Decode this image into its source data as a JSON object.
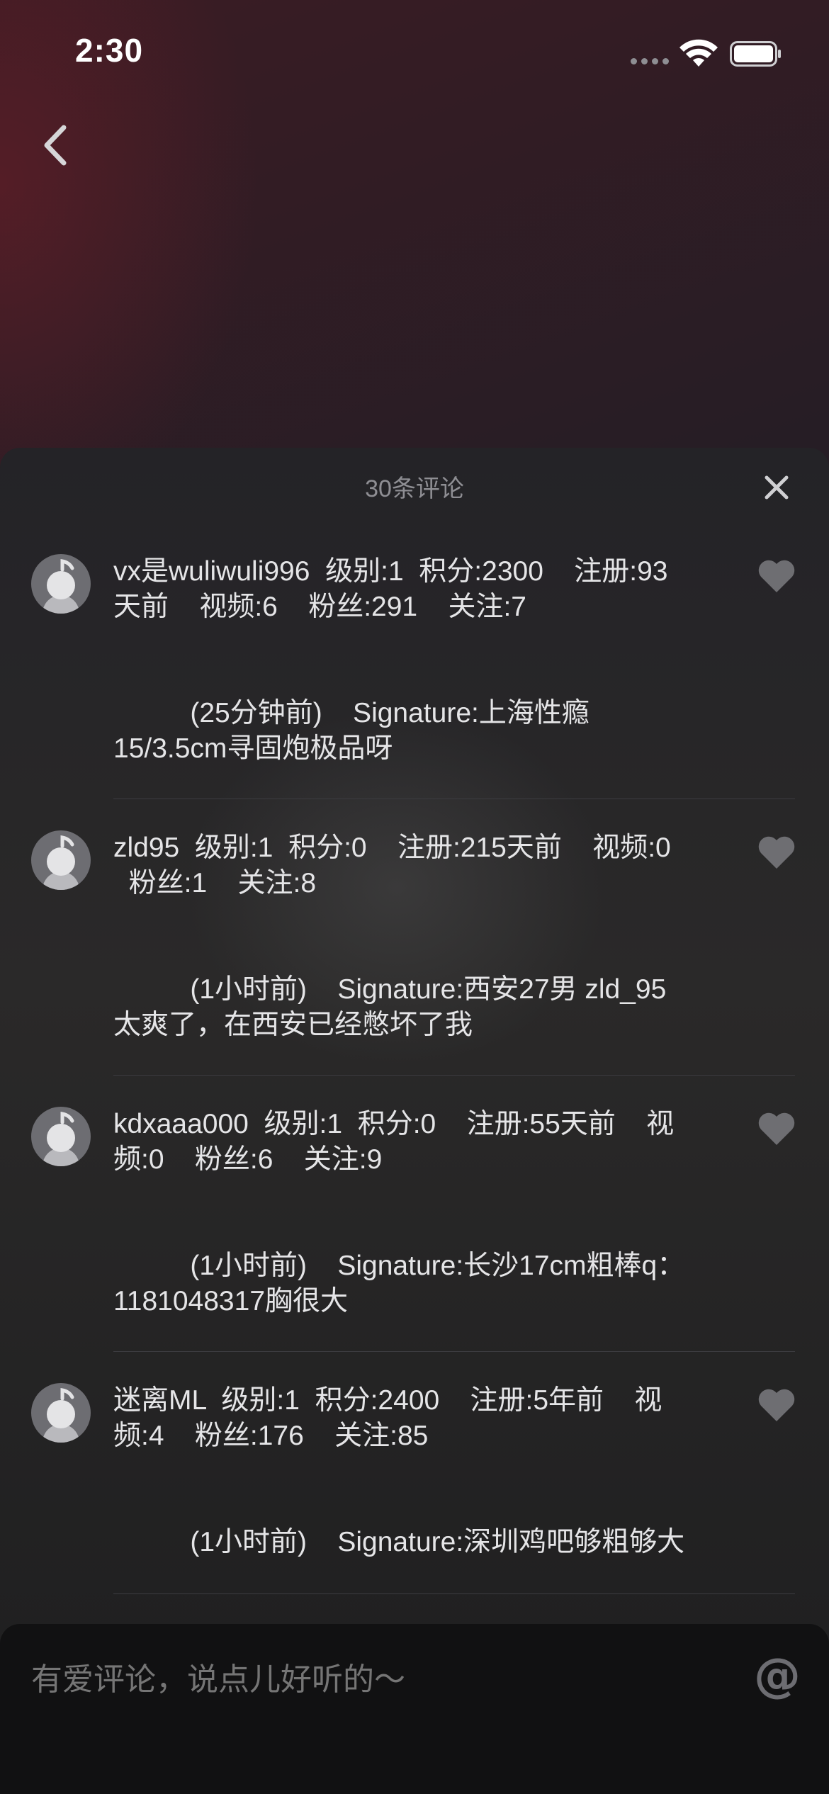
{
  "status_bar": {
    "time": "2:30"
  },
  "sheet": {
    "title": "30条评论"
  },
  "comments": [
    {
      "text": "vx是wuliwuli996  级别:1  积分:2300    注册:93\n天前    视频:6    粉丝:291    关注:7\n\n\n          (25分钟前)    Signature:上海性瘾\n15/3.5cm寻固炮极品呀"
    },
    {
      "text": "zld95  级别:1  积分:0    注册:215天前    视频:0\n  粉丝:1    关注:8\n\n\n          (1小时前)    Signature:西安27男 zld_95\n太爽了，在西安已经憋坏了我"
    },
    {
      "text": "kdxaaa000  级别:1  积分:0    注册:55天前    视\n频:0    粉丝:6    关注:9\n\n\n          (1小时前)    Signature:长沙17cm粗棒q：\n1181048317胸很大"
    },
    {
      "text": "迷离ML  级别:1  积分:2400    注册:5年前    视\n频:4    粉丝:176    关注:85\n\n\n          (1小时前)    Signature:深圳鸡吧够粗够大"
    }
  ],
  "input": {
    "placeholder": "有爱评论，说点儿好听的～",
    "at_symbol": "@"
  },
  "colors": {
    "accent_bg": "#1d1b20",
    "text": "#e5e5e7",
    "muted": "#8e8e93"
  }
}
